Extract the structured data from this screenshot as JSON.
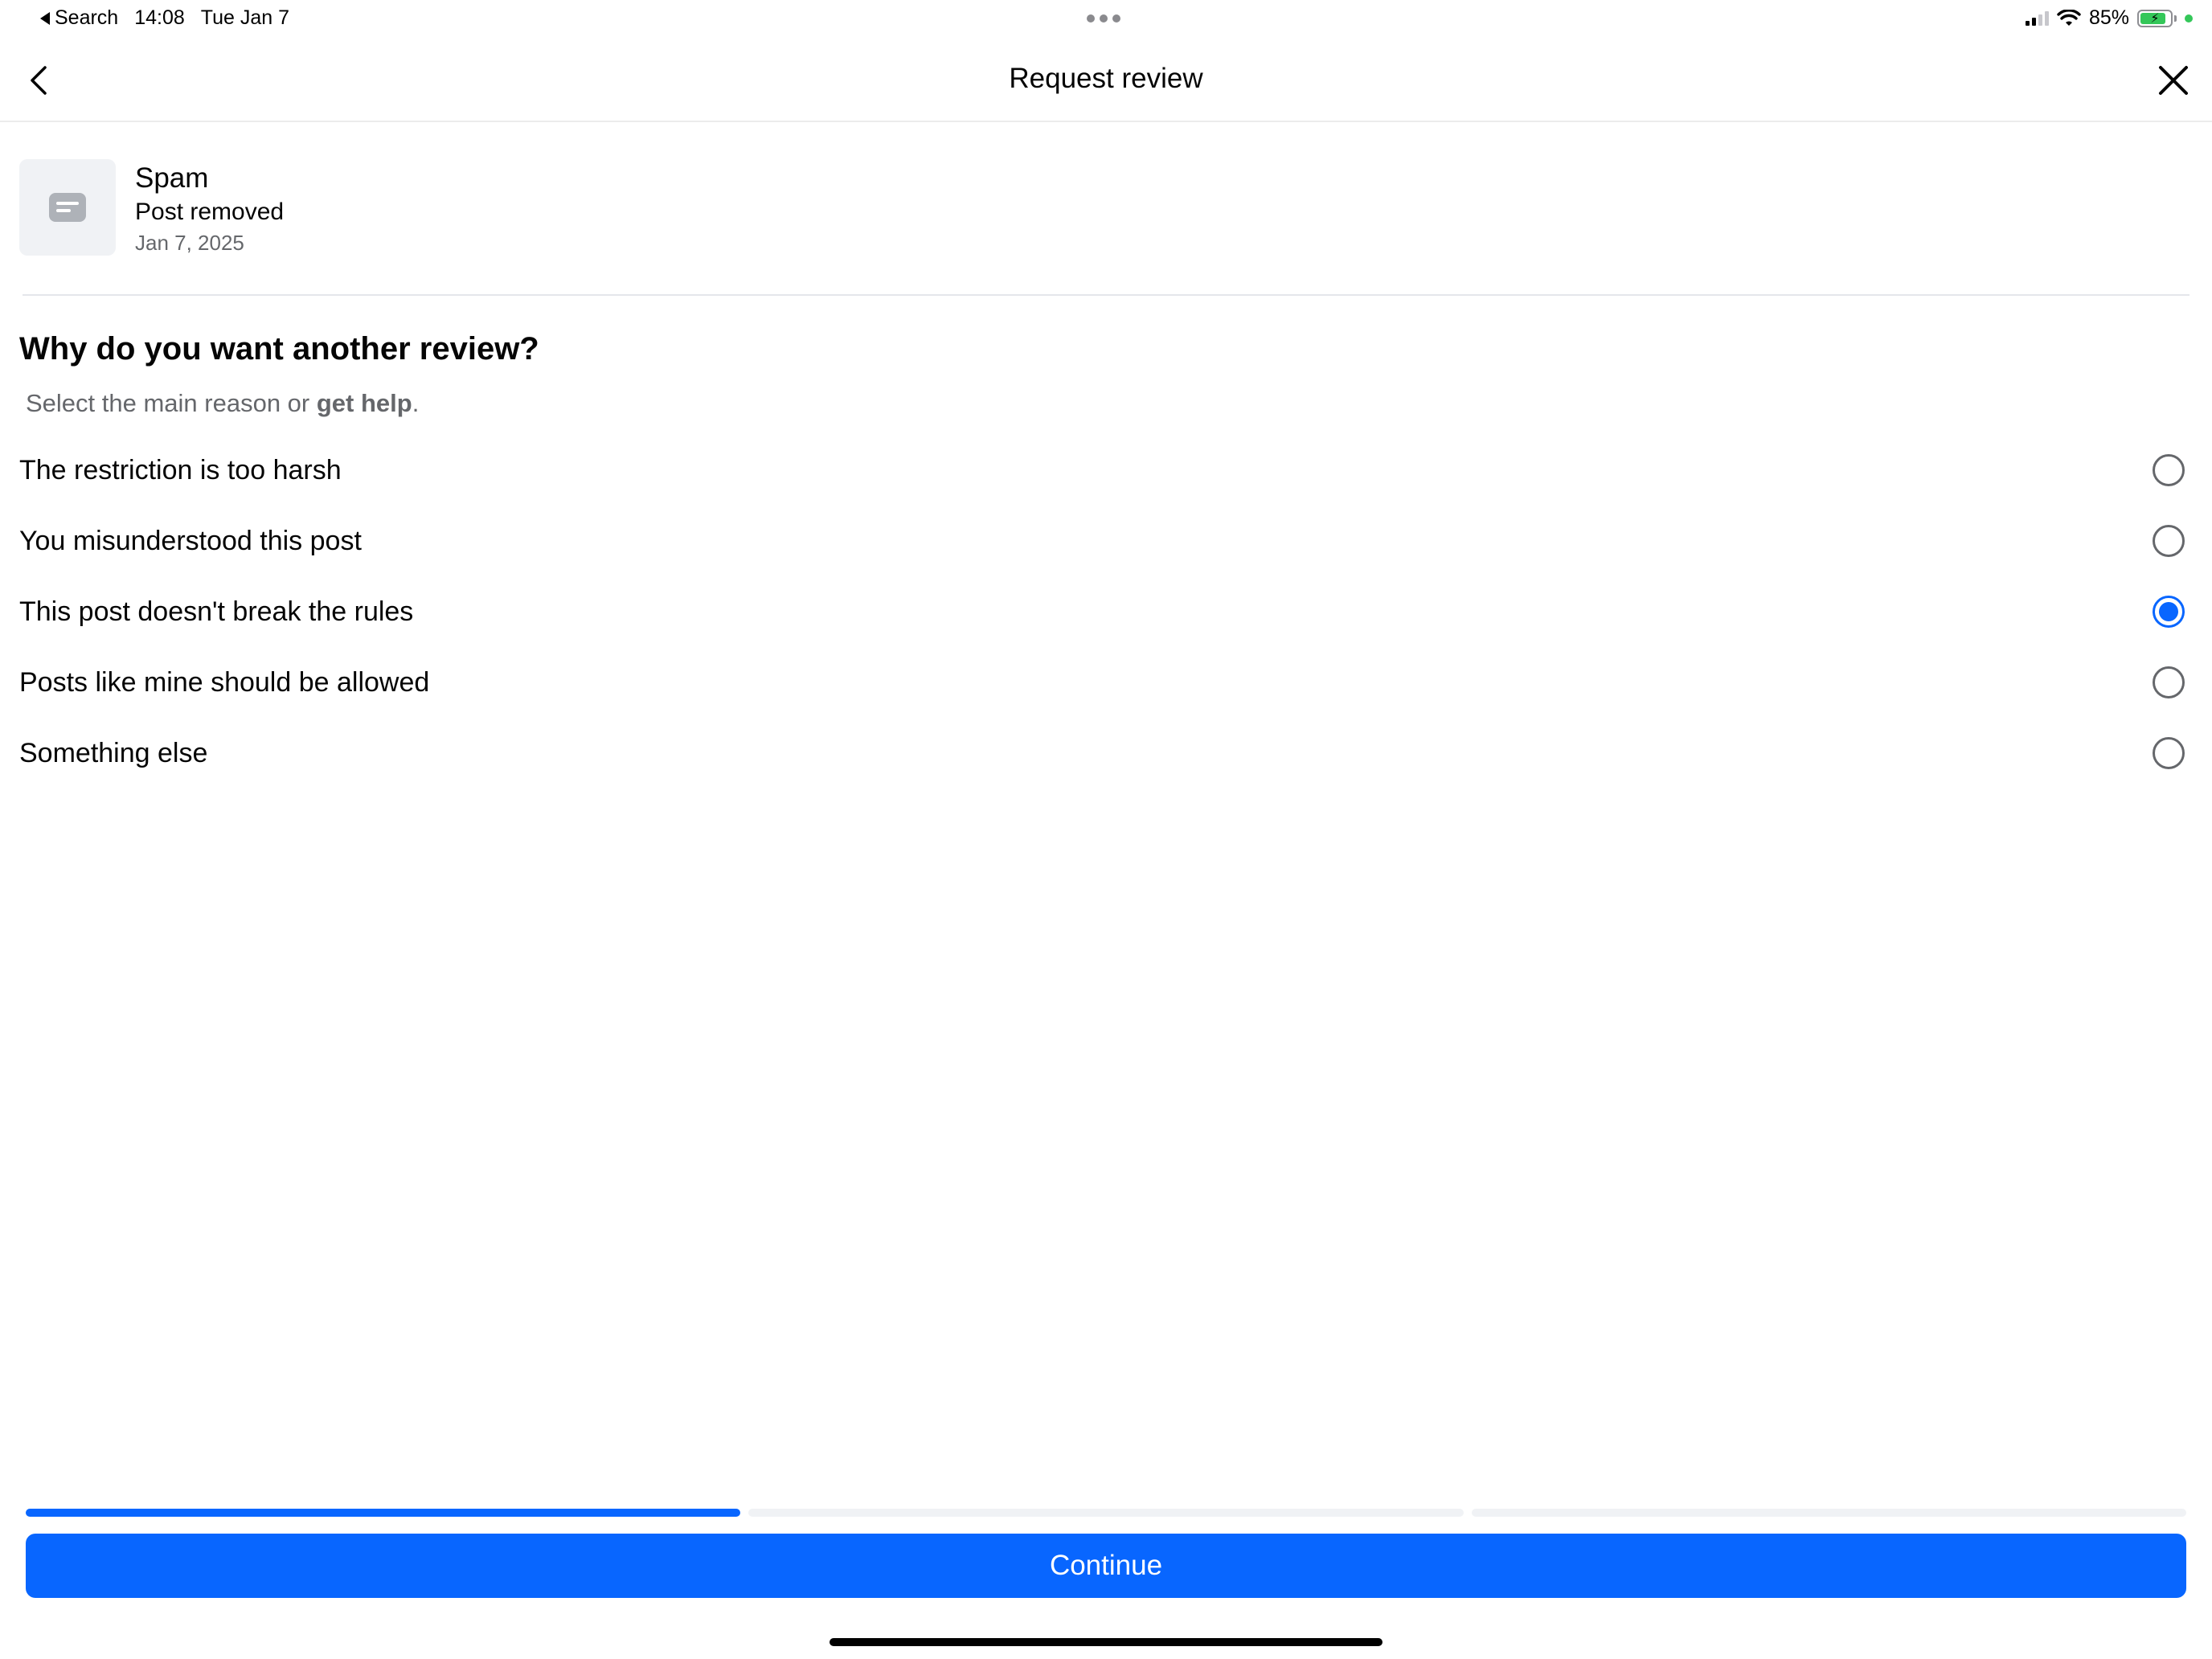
{
  "status_bar": {
    "back_app": "Search",
    "time": "14:08",
    "date": "Tue Jan 7",
    "battery": "85%",
    "battery_level": 0.85
  },
  "header": {
    "title": "Request review",
    "back_icon": "chevron-left-icon",
    "close_icon": "close-icon"
  },
  "item": {
    "category": "Spam",
    "status": "Post removed",
    "date": "Jan 7, 2025"
  },
  "form": {
    "question": "Why do you want another review?",
    "subtitle_prefix": "Select the main reason or ",
    "subtitle_link": "get help",
    "subtitle_suffix": ".",
    "options": [
      {
        "label": "The restriction is too harsh",
        "selected": false
      },
      {
        "label": "You misunderstood this post",
        "selected": false
      },
      {
        "label": "This post doesn't break the rules",
        "selected": true
      },
      {
        "label": "Posts like mine should be allowed",
        "selected": false
      },
      {
        "label": "Something else",
        "selected": false
      }
    ]
  },
  "progress": {
    "current_step": 1,
    "total_steps": 3
  },
  "footer": {
    "continue_label": "Continue"
  },
  "colors": {
    "accent": "#0866ff",
    "secondary_text": "#65676b"
  }
}
